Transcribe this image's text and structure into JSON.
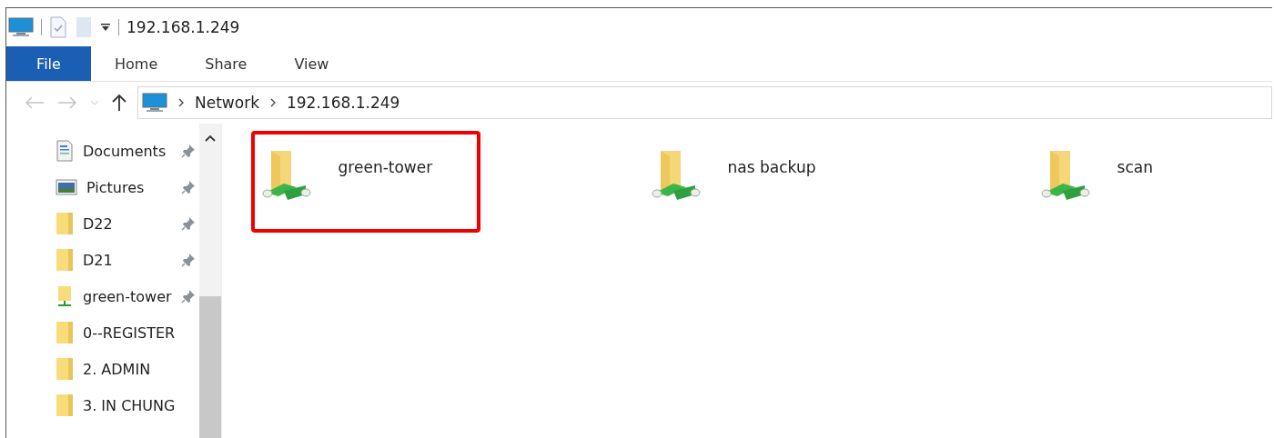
{
  "window": {
    "title": "192.168.1.249"
  },
  "ribbon_tabs": [
    {
      "label": "File",
      "selected": true
    },
    {
      "label": "Home",
      "selected": false
    },
    {
      "label": "Share",
      "selected": false
    },
    {
      "label": "View",
      "selected": false
    }
  ],
  "breadcrumb": [
    "Network",
    "192.168.1.249"
  ],
  "sidebar": {
    "items": [
      {
        "label": "Documents",
        "kind": "documents",
        "pinned": true
      },
      {
        "label": "Pictures",
        "kind": "pictures",
        "pinned": true
      },
      {
        "label": "D22",
        "kind": "folder",
        "pinned": true
      },
      {
        "label": "D21",
        "kind": "folder",
        "pinned": true
      },
      {
        "label": "green-tower",
        "kind": "network",
        "pinned": true
      },
      {
        "label": "0--REGISTER",
        "kind": "folder",
        "pinned": false
      },
      {
        "label": "2. ADMIN",
        "kind": "folder",
        "pinned": false
      },
      {
        "label": "3. IN CHUNG",
        "kind": "folder",
        "pinned": false
      }
    ]
  },
  "shares": [
    {
      "name": "green-tower",
      "highlighted": true
    },
    {
      "name": "nas backup",
      "highlighted": false
    },
    {
      "name": "scan",
      "highlighted": false
    }
  ]
}
